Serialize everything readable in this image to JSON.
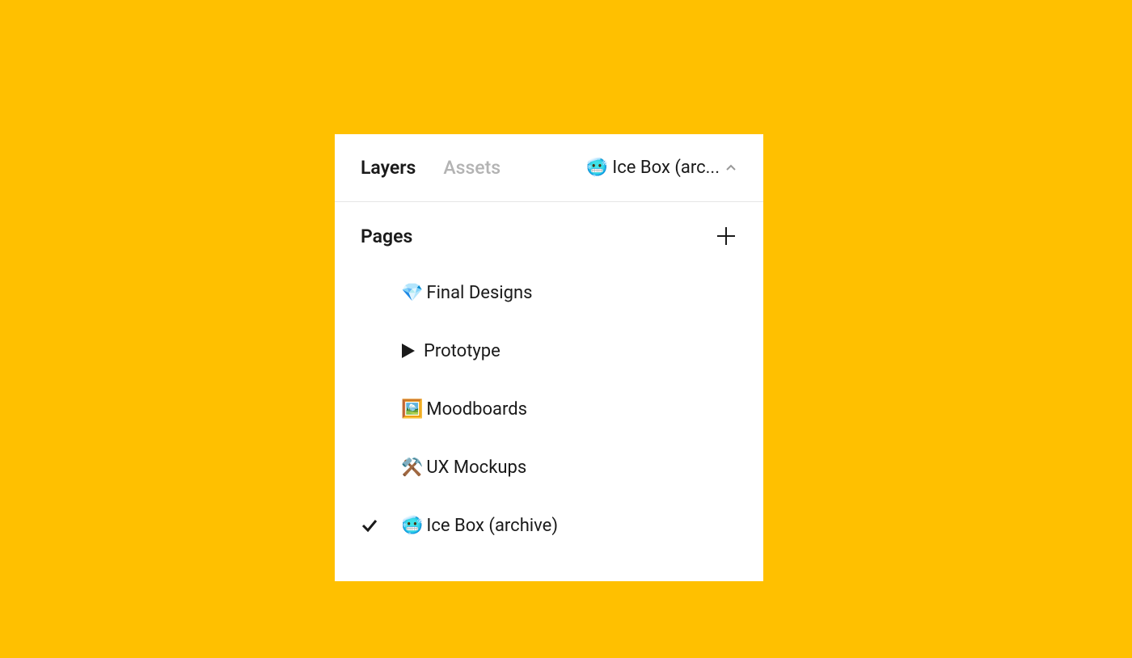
{
  "header": {
    "tabs": [
      {
        "label": "Layers",
        "active": true
      },
      {
        "label": "Assets",
        "active": false
      }
    ],
    "current_page_label": "🥶 Ice Box (arc..."
  },
  "pages_section": {
    "title": "Pages"
  },
  "pages": [
    {
      "emoji": "💎",
      "label": "Final Designs",
      "checked": false,
      "special": ""
    },
    {
      "emoji": "",
      "label": "Prototype",
      "checked": false,
      "special": "prototype"
    },
    {
      "emoji": "🖼️",
      "label": "Moodboards",
      "checked": false,
      "special": ""
    },
    {
      "emoji": "⚒️",
      "label": "UX Mockups",
      "checked": false,
      "special": ""
    },
    {
      "emoji": "🥶",
      "label": "Ice Box (archive)",
      "checked": true,
      "special": ""
    }
  ]
}
